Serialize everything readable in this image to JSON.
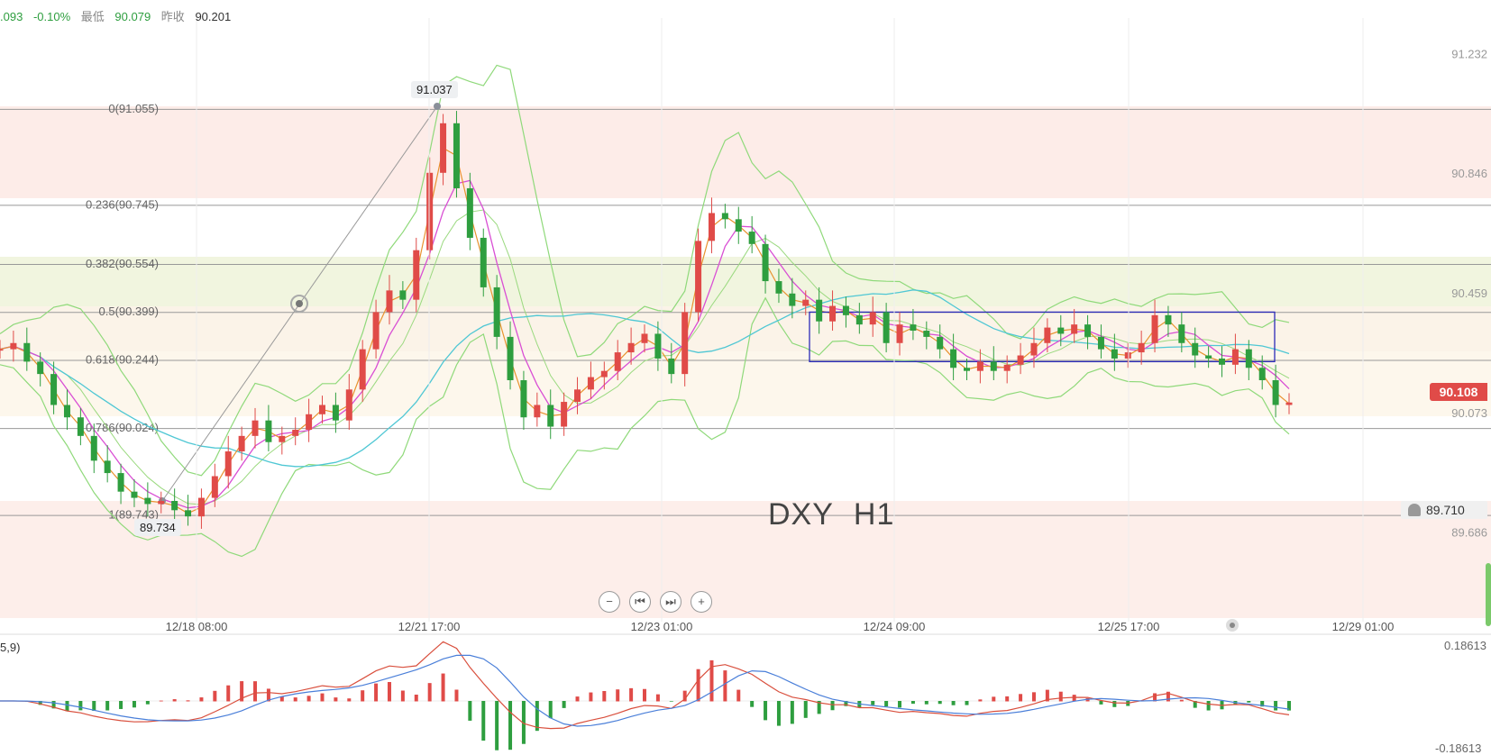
{
  "header": {
    "change": ".093",
    "change_pct": "-0.10%",
    "low_label": "最低",
    "low_value": "90.079",
    "prev_close_label": "昨收",
    "prev_close_value": "90.201"
  },
  "watermark": {
    "symbol": "DXY",
    "timeframe": "H1"
  },
  "current_price": "90.108",
  "alert_price": "89.710",
  "swing_high_label": "91.037",
  "swing_low_label": "89.734",
  "macd_label": "5,9)",
  "macd_top": "0.18613",
  "macd_bottom": "-0.18613",
  "chart_data": {
    "type": "candlestick",
    "title": "DXY H1",
    "y_range": [
      89.4,
      91.35
    ],
    "price_axis_ticks": [
      "91.232",
      "90.846",
      "90.459",
      "90.073",
      "89.686"
    ],
    "time_ticks": [
      "12/18 08:00",
      "12/21 17:00",
      "12/23 01:00",
      "12/24 09:00",
      "12/25 17:00",
      "12/29 01:00"
    ],
    "fibonacci_levels": [
      {
        "label": "0(91.055)",
        "value": 91.055
      },
      {
        "label": "0.236(90.745)",
        "value": 90.745
      },
      {
        "label": "0.382(90.554)",
        "value": 90.554
      },
      {
        "label": "0.5(90.399)",
        "value": 90.399
      },
      {
        "label": "0.618(90.244)",
        "value": 90.244
      },
      {
        "label": "0.786(90.024)",
        "value": 90.024
      },
      {
        "label": "1(89.743)",
        "value": 89.743
      }
    ],
    "price_path": [
      [
        0,
        90.28
      ],
      [
        10,
        90.3
      ],
      [
        20,
        90.24
      ],
      [
        30,
        90.2
      ],
      [
        40,
        90.1
      ],
      [
        50,
        90.06
      ],
      [
        60,
        90.0
      ],
      [
        70,
        89.92
      ],
      [
        80,
        89.88
      ],
      [
        90,
        89.82
      ],
      [
        100,
        89.8
      ],
      [
        110,
        89.78
      ],
      [
        120,
        89.79
      ],
      [
        130,
        89.76
      ],
      [
        140,
        89.74
      ],
      [
        150,
        89.8
      ],
      [
        160,
        89.87
      ],
      [
        170,
        89.95
      ],
      [
        180,
        90.0
      ],
      [
        190,
        90.05
      ],
      [
        200,
        89.98
      ],
      [
        210,
        90.0
      ],
      [
        220,
        90.02
      ],
      [
        230,
        90.07
      ],
      [
        240,
        90.1
      ],
      [
        250,
        90.05
      ],
      [
        260,
        90.15
      ],
      [
        270,
        90.28
      ],
      [
        280,
        90.4
      ],
      [
        290,
        90.47
      ],
      [
        300,
        90.44
      ],
      [
        310,
        90.6
      ],
      [
        320,
        90.85
      ],
      [
        330,
        91.01
      ],
      [
        340,
        90.8
      ],
      [
        350,
        90.64
      ],
      [
        360,
        90.48
      ],
      [
        370,
        90.32
      ],
      [
        380,
        90.18
      ],
      [
        390,
        90.06
      ],
      [
        400,
        90.1
      ],
      [
        410,
        90.03
      ],
      [
        420,
        90.11
      ],
      [
        430,
        90.15
      ],
      [
        440,
        90.19
      ],
      [
        450,
        90.21
      ],
      [
        460,
        90.27
      ],
      [
        470,
        90.3
      ],
      [
        480,
        90.33
      ],
      [
        490,
        90.25
      ],
      [
        500,
        90.2
      ],
      [
        510,
        90.4
      ],
      [
        520,
        90.63
      ],
      [
        530,
        90.72
      ],
      [
        540,
        90.7
      ],
      [
        550,
        90.66
      ],
      [
        560,
        90.62
      ],
      [
        570,
        90.5
      ],
      [
        580,
        90.46
      ],
      [
        590,
        90.42
      ],
      [
        600,
        90.44
      ],
      [
        610,
        90.37
      ],
      [
        620,
        90.42
      ],
      [
        630,
        90.39
      ],
      [
        640,
        90.36
      ],
      [
        650,
        90.4
      ],
      [
        660,
        90.3
      ],
      [
        670,
        90.36
      ],
      [
        680,
        90.34
      ],
      [
        690,
        90.32
      ],
      [
        700,
        90.28
      ],
      [
        710,
        90.22
      ],
      [
        720,
        90.21
      ],
      [
        730,
        90.24
      ],
      [
        740,
        90.21
      ],
      [
        750,
        90.23
      ],
      [
        760,
        90.26
      ],
      [
        770,
        90.3
      ],
      [
        780,
        90.35
      ],
      [
        790,
        90.33
      ],
      [
        800,
        90.36
      ],
      [
        810,
        90.32
      ],
      [
        820,
        90.28
      ],
      [
        830,
        90.25
      ],
      [
        840,
        90.27
      ],
      [
        850,
        90.3
      ],
      [
        860,
        90.39
      ],
      [
        870,
        90.36
      ],
      [
        880,
        90.3
      ],
      [
        890,
        90.26
      ],
      [
        900,
        90.25
      ],
      [
        910,
        90.23
      ],
      [
        920,
        90.28
      ],
      [
        930,
        90.22
      ],
      [
        940,
        90.18
      ],
      [
        950,
        90.1
      ],
      [
        960,
        90.108
      ]
    ],
    "consolidation_box": {
      "y_top": 90.4,
      "y_bottom": 90.24
    },
    "macd": {
      "range": [
        -0.18613,
        0.18613
      ]
    }
  }
}
